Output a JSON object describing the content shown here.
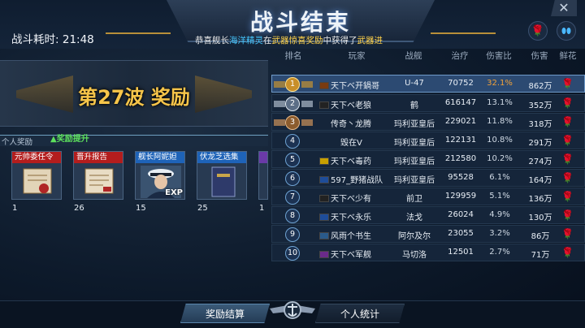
{
  "header": {
    "title": "战斗结束",
    "battle_time_label": "战斗耗时:",
    "battle_time_value": "21:48",
    "ticker": {
      "p1": "恭喜舰长",
      "name": "海洋精灵",
      "p2": "在",
      "event": "武器惊喜奖励",
      "p3": "中获得了",
      "reward": "武器进"
    },
    "close_icon": "✕"
  },
  "banner": {
    "text": "第27波 奖励"
  },
  "rewards": {
    "personal_label": "个人奖励",
    "upgrade_label": "奖励提升",
    "items": [
      {
        "title": "元帅委任令",
        "qty": "1",
        "color": "#b31d1d",
        "icon": "scroll-icon"
      },
      {
        "title": "晋升报告",
        "qty": "26",
        "color": "#b31d1d",
        "icon": "report-icon"
      },
      {
        "title": "舰长阿妮妲",
        "qty": "15",
        "color": "#1e63b8",
        "icon": "captain-portrait",
        "exp": "EXP"
      },
      {
        "title": "伏龙芝选集",
        "qty": "25",
        "color": "#1e63b8",
        "icon": "book-icon"
      },
      {
        "title": "",
        "qty": "1",
        "color": "#6a3aa8",
        "icon": "partial-card"
      }
    ]
  },
  "table": {
    "headers": [
      "排名",
      "玩家",
      "战舰",
      "治疗",
      "伤害比",
      "伤害",
      "鲜花"
    ],
    "rows": [
      {
        "rank": "1",
        "player": "天下ベ开鍋哥",
        "ship": "U-47",
        "heal": "70752",
        "ratio": "32.1%",
        "damage": "862万",
        "flag": "#7a3b10"
      },
      {
        "rank": "2",
        "player": "天下ベ老狼",
        "ship": "鹤",
        "heal": "616147",
        "ratio": "13.1%",
        "damage": "352万",
        "flag": "#222"
      },
      {
        "rank": "3",
        "player": "传奇丶龙腾",
        "ship": "玛利亚皇后",
        "heal": "229021",
        "ratio": "11.8%",
        "damage": "318万",
        "flag": ""
      },
      {
        "rank": "4",
        "player": "毁在V",
        "ship": "玛利亚皇后",
        "heal": "122131",
        "ratio": "10.8%",
        "damage": "291万",
        "flag": ""
      },
      {
        "rank": "5",
        "player": "天下ベ毒药",
        "ship": "玛利亚皇后",
        "heal": "212580",
        "ratio": "10.2%",
        "damage": "274万",
        "flag": "#c8a000"
      },
      {
        "rank": "6",
        "player": "597_野猪战队",
        "ship": "玛利亚皇后",
        "heal": "95528",
        "ratio": "6.1%",
        "damage": "164万",
        "flag": "#1e4d9a"
      },
      {
        "rank": "7",
        "player": "天下ベ少有",
        "ship": "前卫",
        "heal": "129959",
        "ratio": "5.1%",
        "damage": "136万",
        "flag": "#222"
      },
      {
        "rank": "8",
        "player": "天下ベ永乐",
        "ship": "法戈",
        "heal": "26024",
        "ratio": "4.9%",
        "damage": "130万",
        "flag": "#1e4d9a"
      },
      {
        "rank": "9",
        "player": "风雨个书生",
        "ship": "阿尔及尔",
        "heal": "23055",
        "ratio": "3.2%",
        "damage": "86万",
        "flag": "#2a5a8a"
      },
      {
        "rank": "10",
        "player": "天下ベ军舰",
        "ship": "马切洛",
        "heal": "12501",
        "ratio": "2.7%",
        "damage": "71万",
        "flag": "#6a2a8a"
      }
    ]
  },
  "footer": {
    "tab_rewards": "奖励结算",
    "tab_stats": "个人统计"
  }
}
